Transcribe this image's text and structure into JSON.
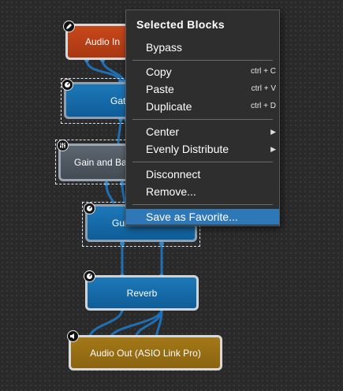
{
  "blocks": {
    "audio_in": {
      "label": "Audio In"
    },
    "gate": {
      "label": "Gate"
    },
    "gain_bass": {
      "label": "Gain and Bass"
    },
    "guitar_effects": {
      "label": "Guitar Effects"
    },
    "reverb": {
      "label": "Reverb"
    },
    "audio_out": {
      "label": "Audio Out (ASIO Link Pro)"
    }
  },
  "context_menu": {
    "header": "Selected Blocks",
    "bypass": "Bypass",
    "copy": {
      "label": "Copy",
      "shortcut": "ctrl + C"
    },
    "paste": {
      "label": "Paste",
      "shortcut": "ctrl + V"
    },
    "duplicate": {
      "label": "Duplicate",
      "shortcut": "ctrl + D"
    },
    "center": {
      "label": "Center",
      "arrow": "▶"
    },
    "evenly_distribute": {
      "label": "Evenly Distribute",
      "arrow": "▶"
    },
    "disconnect": "Disconnect",
    "remove": "Remove...",
    "save_favorite": "Save as Favorite..."
  },
  "colors": {
    "background": "#2a2a2a",
    "wire": "#1f6fb5",
    "menu_highlight": "#2f78b8",
    "audio_in": "#c8481a",
    "audio_out": "#a37818",
    "effect_block": "#1d78b8"
  },
  "icons": {
    "audio_in_badge": "pencil-icon",
    "effect_badge": "knob-icon",
    "gain_badge": "sliders-icon",
    "audio_out_badge": "speaker-icon"
  }
}
